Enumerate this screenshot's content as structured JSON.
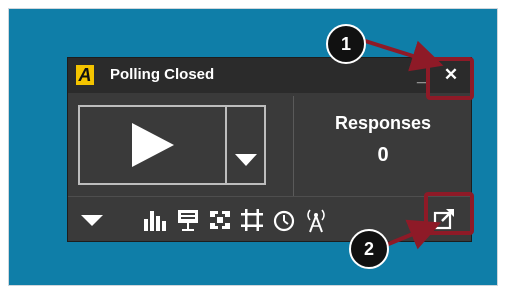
{
  "window": {
    "title": "Polling Closed",
    "logo_letter": "A",
    "minimize_glyph": "_",
    "close_glyph": "✕"
  },
  "responses": {
    "label": "Responses",
    "count": "0"
  },
  "toolbar": {
    "icons": [
      "chevron-down-icon",
      "bar-chart-icon",
      "presentation-icon",
      "fullscreen-icon",
      "crop-icon",
      "timer-icon",
      "broadcast-icon",
      "popout-icon"
    ]
  },
  "annotations": {
    "callout_1": "1",
    "callout_2": "2",
    "callout_color": "#8e1a27"
  },
  "colors": {
    "background": "#0f7ea8",
    "widget": "#3a3a3a",
    "logo": "#f4c400"
  }
}
